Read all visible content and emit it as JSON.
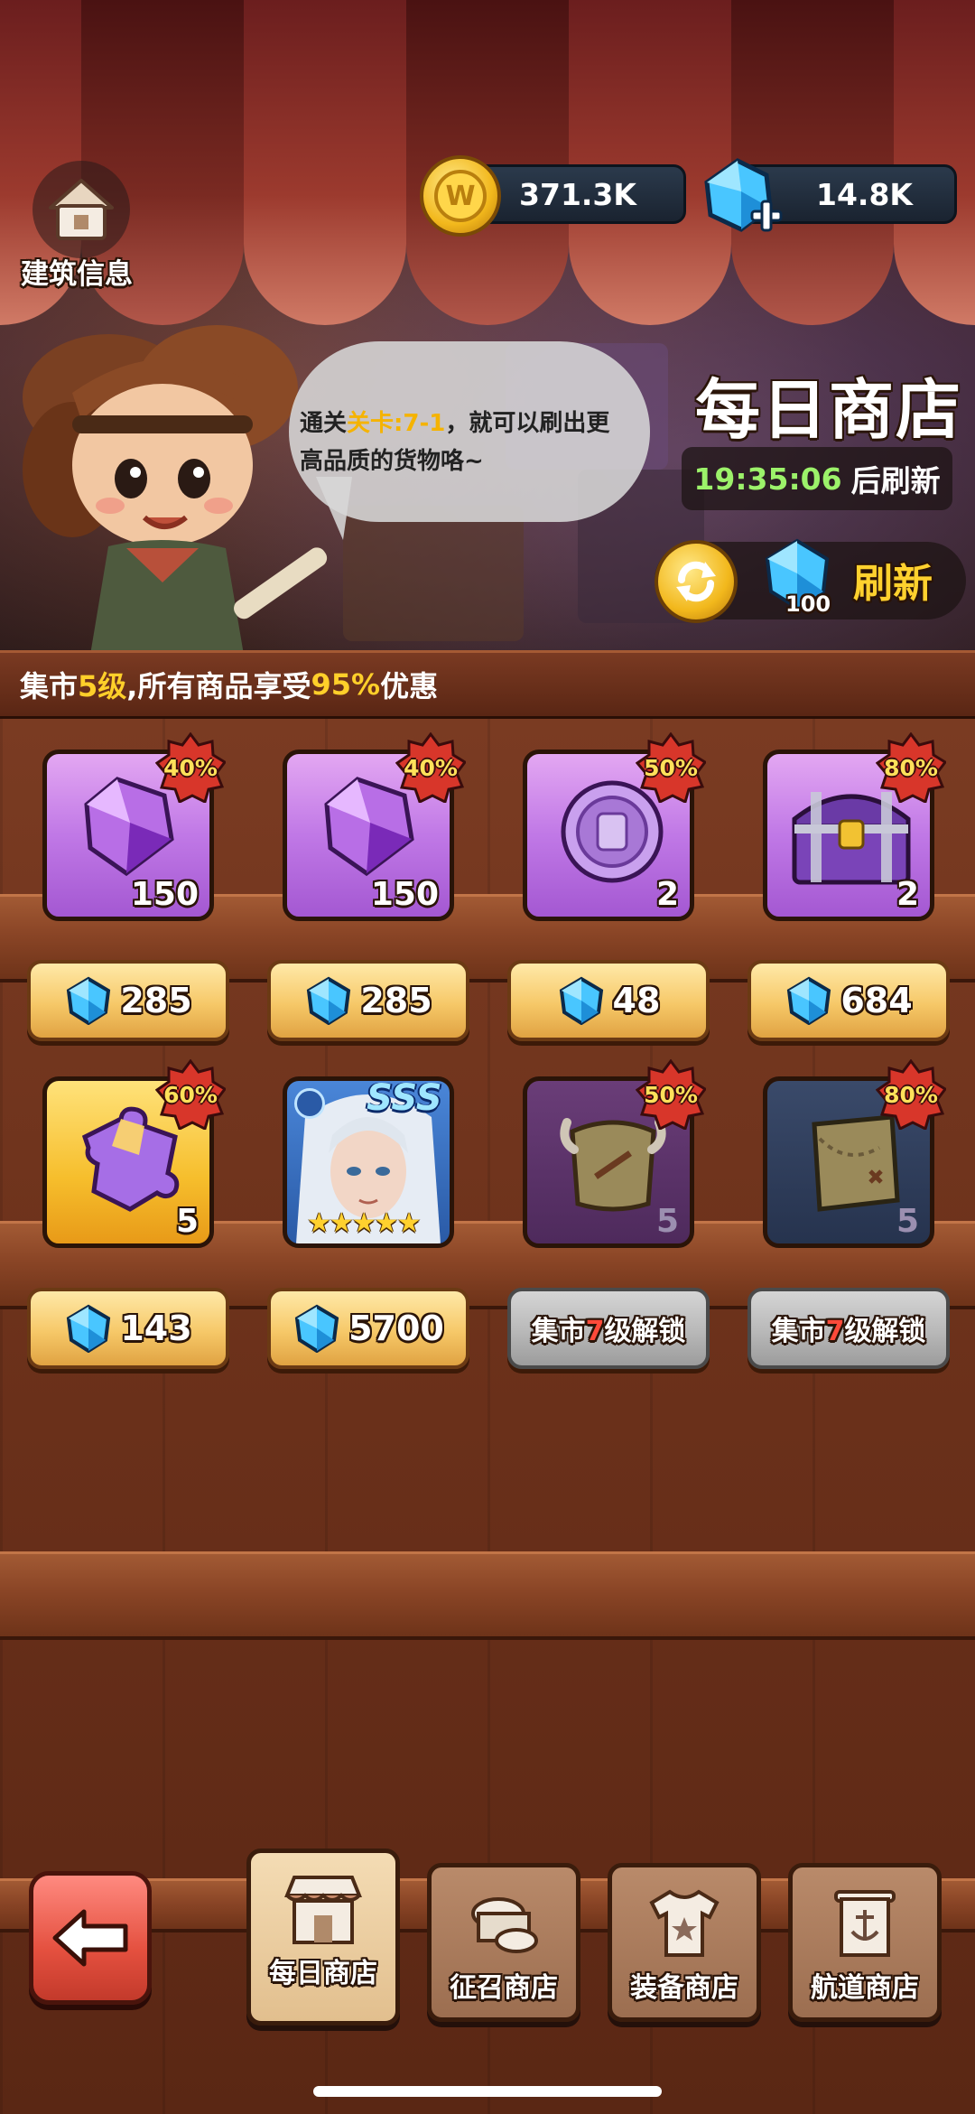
{
  "header": {
    "building_info_label": "建筑信息",
    "gold_amount": "371.3K",
    "gem_amount": "14.8K"
  },
  "banner": {
    "bubble_prefix": "通关",
    "bubble_highlight": "关卡:7-1",
    "bubble_suffix": "，就可以刷出更高品质的货物咯~",
    "shop_title": "每日商店",
    "timer_value": "19:35:06",
    "timer_suffix": "后刷新",
    "refresh_label": "刷新",
    "refresh_cost": "100"
  },
  "info_strip": {
    "part1": "集市",
    "level": "5级",
    "part2": ",所有商品享受",
    "discount": "95%",
    "part3": "优惠"
  },
  "items": [
    {
      "icon": "purple-crystal-icon",
      "qty": "150",
      "badge": "40%",
      "price": "285"
    },
    {
      "icon": "purple-crystal-icon",
      "qty": "150",
      "badge": "40%",
      "price": "285"
    },
    {
      "icon": "purple-coin-icon",
      "qty": "2",
      "badge": "50%",
      "price": "48"
    },
    {
      "icon": "purple-chest-icon",
      "qty": "2",
      "badge": "80%",
      "price": "684"
    },
    {
      "icon": "puzzle-piece-icon",
      "qty": "5",
      "badge": "60%",
      "price": "143"
    },
    {
      "icon": "hero-portrait-icon",
      "rank": "SSS",
      "stars": "★★★★★",
      "price": "5700"
    },
    {
      "icon": "leather-scroll-icon",
      "qty": "5",
      "badge": "50%",
      "locked_a": "集市",
      "locked_lv": "7",
      "locked_b": "级解锁"
    },
    {
      "icon": "treasure-map-icon",
      "qty": "5",
      "badge": "80%",
      "locked_a": "集市",
      "locked_lv": "7",
      "locked_b": "级解锁"
    }
  ],
  "nav": {
    "tabs": [
      {
        "label": "每日商店",
        "active": true
      },
      {
        "label": "征召商店"
      },
      {
        "label": "装备商店"
      },
      {
        "label": "航道商店"
      }
    ]
  },
  "colors": {
    "highlight_yellow": "#ffcf2a",
    "timer_green": "#9cf26a",
    "locked_red": "#ff4a3a"
  }
}
